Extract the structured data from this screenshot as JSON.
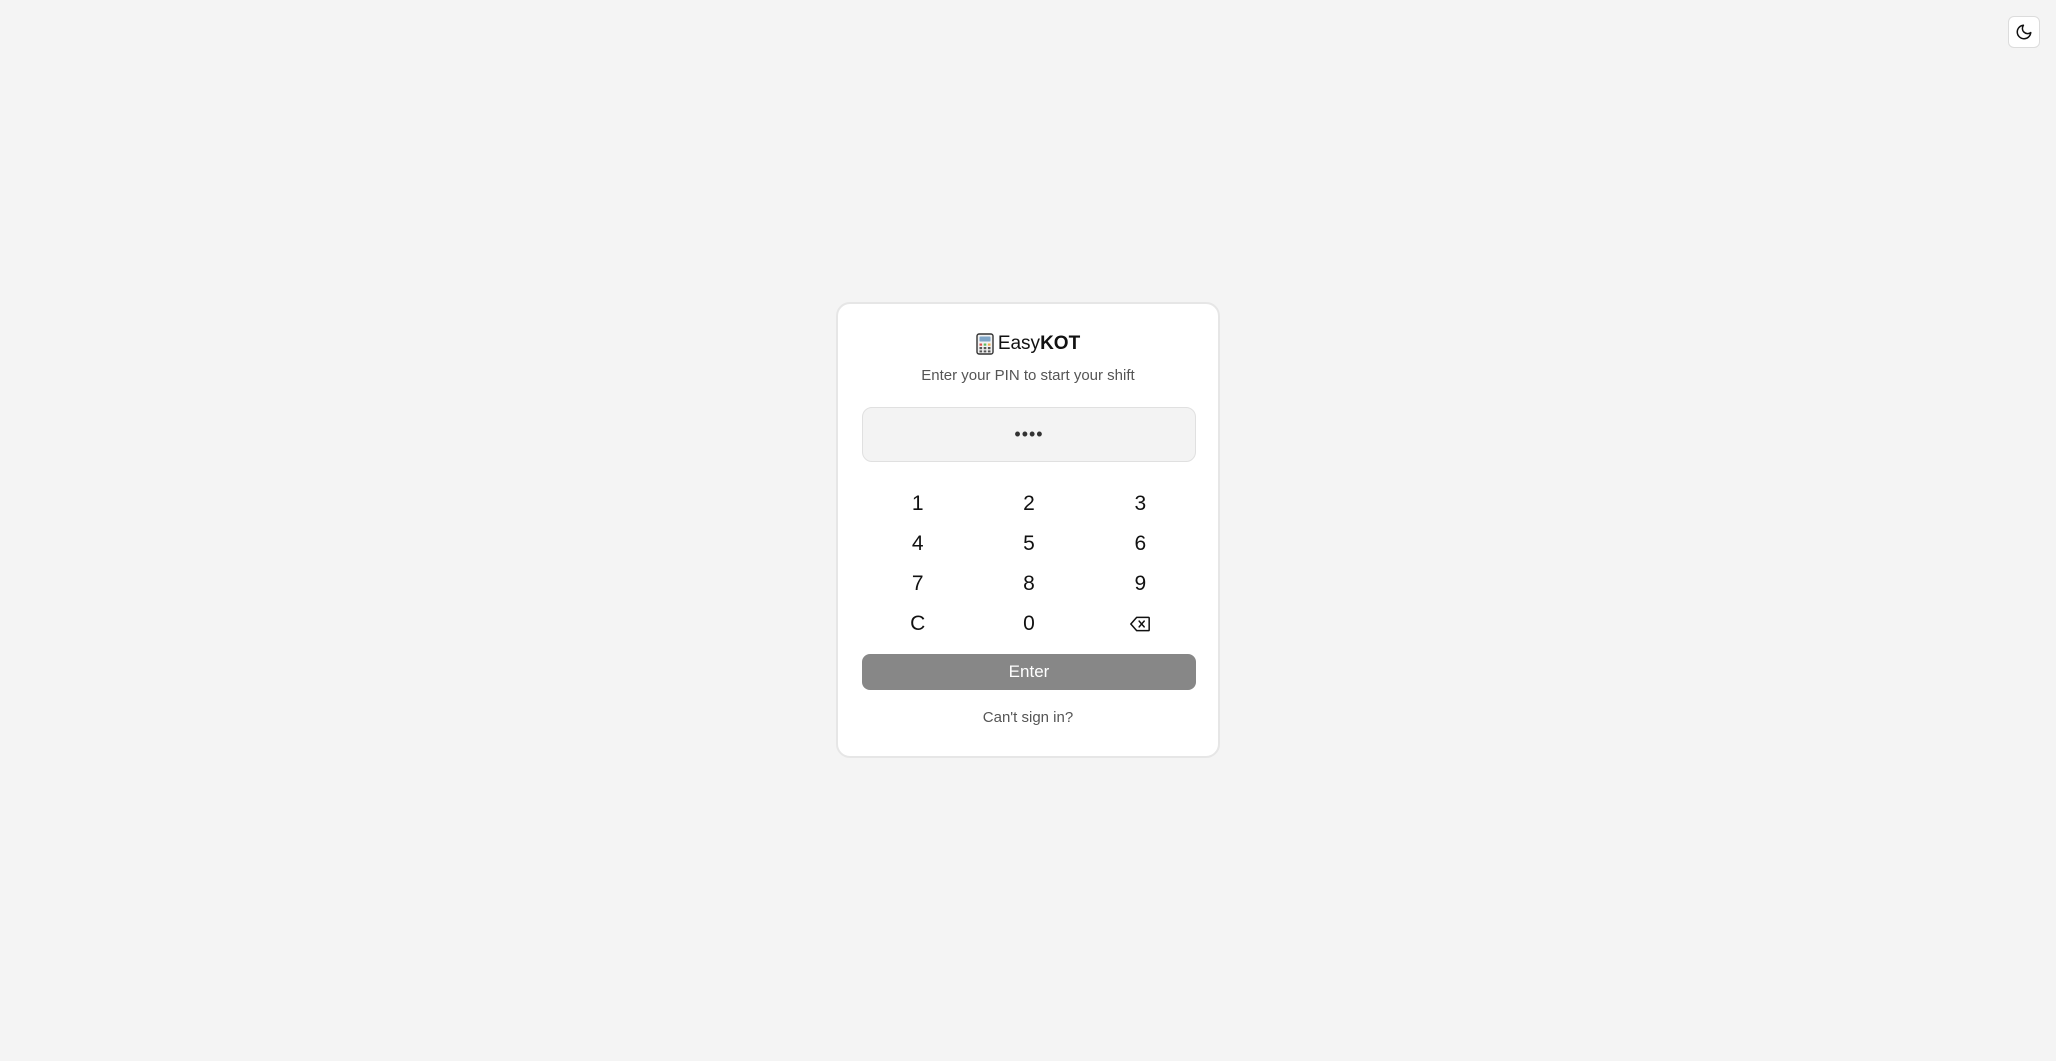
{
  "theme_toggle": {
    "icon": "moon-icon"
  },
  "brand": {
    "icon": "calculator-icon",
    "name_part1": "Easy",
    "name_part2": "KOT"
  },
  "subtitle": "Enter your PIN to start your shift",
  "pin_display": {
    "masked_value": "••••"
  },
  "keypad": {
    "keys": [
      "1",
      "2",
      "3",
      "4",
      "5",
      "6",
      "7",
      "8",
      "9",
      "C",
      "0"
    ],
    "backspace_icon": "backspace-icon"
  },
  "enter_label": "Enter",
  "help_link": "Can't sign in?",
  "colors": {
    "background": "#f4f4f4",
    "card": "#ffffff",
    "enter_button": "#878787"
  }
}
